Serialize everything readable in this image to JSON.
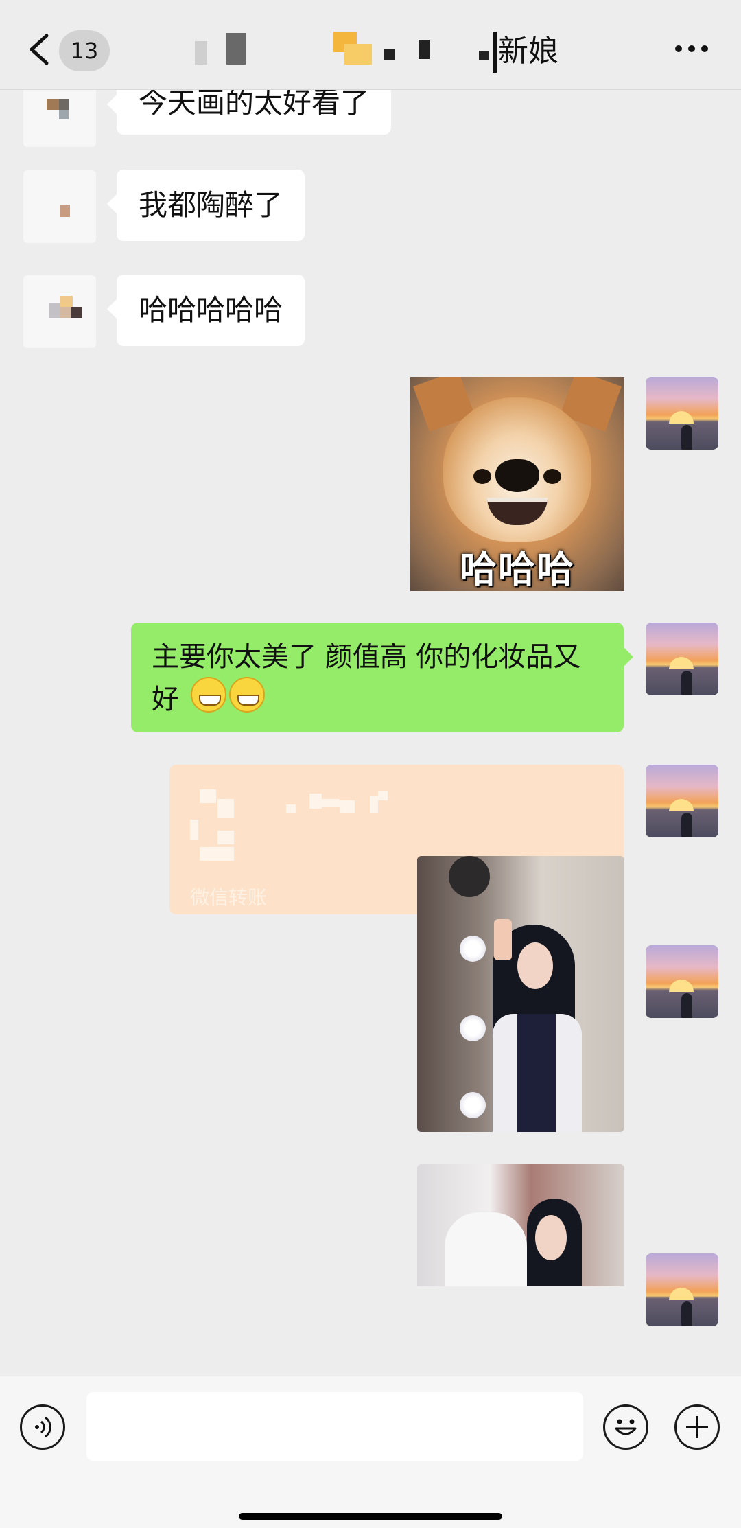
{
  "header": {
    "unread_count": "13",
    "title_suffix": "新娘"
  },
  "messages": {
    "left_1": "今天画的太好看了",
    "left_2": "我都陶醉了",
    "left_3": "哈哈哈哈哈",
    "dog_sticker_caption": "哈哈哈",
    "right_text": "主要你太美了 颜值高 你的化妆品又好",
    "transfer_label": "微信转账"
  },
  "icons": {
    "back": "chevron-left-icon",
    "more": "ellipsis-icon",
    "voice": "voice-icon",
    "emoji": "smiley-icon",
    "plus": "plus-icon"
  },
  "colors": {
    "background": "#ededed",
    "self_bubble": "#95ec69",
    "other_bubble": "#ffffff",
    "transfer_card": "#fde2c9"
  }
}
